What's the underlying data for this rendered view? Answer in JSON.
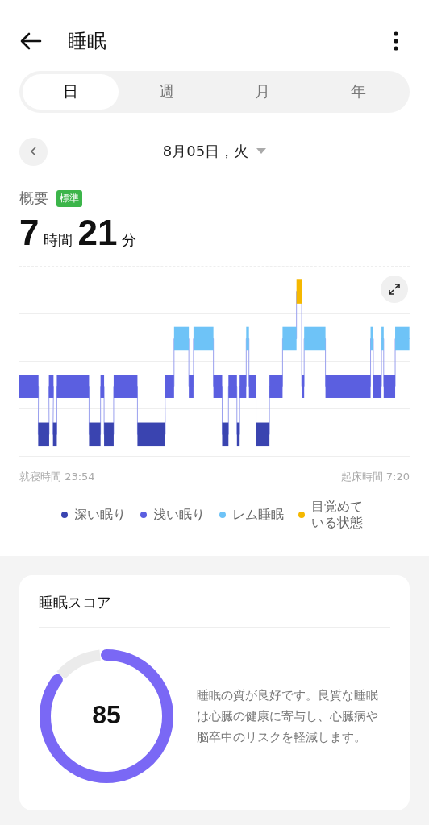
{
  "header": {
    "title": "睡眠"
  },
  "tabs": [
    {
      "label": "日",
      "selected": true
    },
    {
      "label": "週",
      "selected": false
    },
    {
      "label": "月",
      "selected": false
    },
    {
      "label": "年",
      "selected": false
    }
  ],
  "date": {
    "label": "8月05日，火"
  },
  "summary": {
    "label": "概要",
    "badge": "標準",
    "hours": "7",
    "hours_unit": "時間",
    "minutes": "21",
    "minutes_unit": "分"
  },
  "chart": {
    "kind": "picture",
    "bedtime": "就寝時間 23:54",
    "wake_time": "起床時間 7:20"
  },
  "legend": [
    {
      "label": "深い眠り",
      "color": "#3a44b0"
    },
    {
      "label": "浅い眠り",
      "color": "#5b5fe0"
    },
    {
      "label": "レム睡眠",
      "color": "#6ec3f7"
    },
    {
      "label": "目覚めている状態",
      "color": "#f5b800"
    }
  ],
  "score_card": {
    "title": "睡眠スコア",
    "score": "85",
    "description": "睡眠の質が良好です。良質な睡眠は心臓の健康に寄与し、心臓病や脳卒中のリスクを軽減します。"
  }
}
